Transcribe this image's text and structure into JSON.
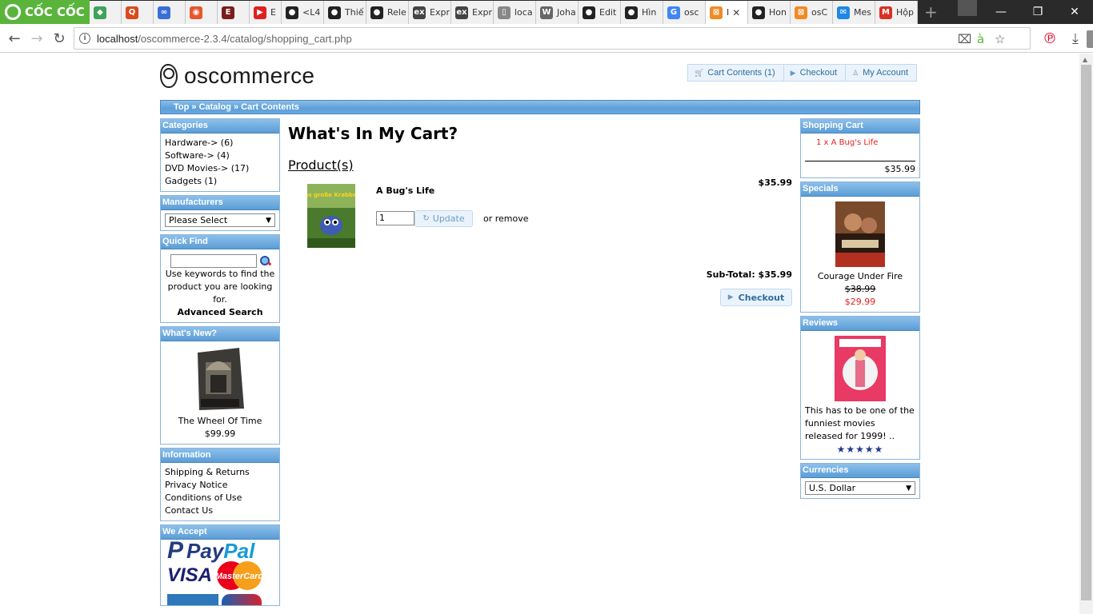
{
  "browser": {
    "brand": "CỐC CỐC",
    "tabs": [
      {
        "label": "",
        "color": "#3fa35a",
        "glyph": "◆"
      },
      {
        "label": "",
        "color": "#d94a1e",
        "glyph": "Q"
      },
      {
        "label": "",
        "color": "#3a6fd8",
        "glyph": "∞"
      },
      {
        "label": "",
        "color": "#e4572e",
        "glyph": "◉"
      },
      {
        "label": "",
        "color": "#7a1d1d",
        "glyph": "E"
      },
      {
        "label": "E",
        "color": "#e02020",
        "glyph": "▶"
      },
      {
        "label": "<L4",
        "color": "#222222",
        "glyph": "●"
      },
      {
        "label": "Thiế",
        "color": "#222222",
        "glyph": "●"
      },
      {
        "label": "Rele",
        "color": "#222222",
        "glyph": "●"
      },
      {
        "label": "Expr",
        "color": "#444444",
        "glyph": "ex"
      },
      {
        "label": "Expr",
        "color": "#444444",
        "glyph": "ex"
      },
      {
        "label": "loca",
        "color": "#888888",
        "glyph": "▯"
      },
      {
        "label": "Joha",
        "color": "#666666",
        "glyph": "W"
      },
      {
        "label": "Edit",
        "color": "#222222",
        "glyph": "●"
      },
      {
        "label": "Hìn",
        "color": "#222222",
        "glyph": "●"
      },
      {
        "label": "osc",
        "color": "#4285f4",
        "glyph": "G"
      },
      {
        "label": "I",
        "color": "#f08a24",
        "glyph": "⊠",
        "active": true
      },
      {
        "label": "Hon",
        "color": "#222222",
        "glyph": "●"
      },
      {
        "label": "osC",
        "color": "#f08a24",
        "glyph": "⊠"
      },
      {
        "label": "Mes",
        "color": "#1e88e5",
        "glyph": "✉"
      },
      {
        "label": "Hộp",
        "color": "#d93025",
        "glyph": "M"
      }
    ],
    "url_host": "localhost",
    "url_path": "/oscommerce-2.3.4/catalog/shopping_cart.php"
  },
  "site": {
    "logo_text": "oscommerce",
    "header_nav": {
      "cart": "Cart Contents (1)",
      "checkout": "Checkout",
      "account": "My Account"
    },
    "breadcrumb": "Top » Catalog » Cart Contents"
  },
  "left": {
    "categories": {
      "title": "Categories",
      "items": [
        "Hardware-> (6)",
        "Software-> (4)",
        "DVD Movies-> (17)",
        "Gadgets (1)"
      ]
    },
    "manufacturers": {
      "title": "Manufacturers",
      "selected": "Please Select"
    },
    "quick_find": {
      "title": "Quick Find",
      "help": "Use keywords to find the product you are looking for.",
      "advanced": "Advanced Search"
    },
    "whats_new": {
      "title": "What's New?",
      "name": "The Wheel Of Time",
      "price": "$99.99"
    },
    "information": {
      "title": "Information",
      "items": [
        "Shipping & Returns",
        "Privacy Notice",
        "Conditions of Use",
        "Contact Us"
      ]
    },
    "we_accept": {
      "title": "We Accept",
      "paypal_a": "Pay",
      "paypal_b": "Pal",
      "visa": "VISA",
      "mastercard": "MasterCard"
    }
  },
  "main": {
    "title": "What's In My Cart?",
    "products_heading": "Product(s)",
    "item": {
      "name": "A Bug's Life",
      "price": "$35.99",
      "qty": "1",
      "cover_text": "Das große Krabbeln"
    },
    "update_label": "Update",
    "remove_text": "or remove",
    "subtotal": "Sub-Total: $35.99",
    "checkout_label": "Checkout"
  },
  "right": {
    "shopping_cart": {
      "title": "Shopping Cart",
      "line": "1 x A Bug's Life",
      "total": "$35.99"
    },
    "specials": {
      "title": "Specials",
      "name": "Courage Under Fire",
      "old_price": "$38.99",
      "new_price": "$29.99"
    },
    "reviews": {
      "title": "Reviews",
      "text": "This has to be one of the funniest movies released for 1999! ..",
      "stars": "★★★★★"
    },
    "currencies": {
      "title": "Currencies",
      "selected": "U.S. Dollar"
    }
  }
}
